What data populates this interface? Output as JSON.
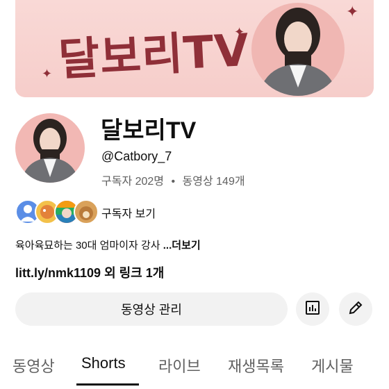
{
  "banner": {
    "title": "달보리TV"
  },
  "channel": {
    "name": "달보리TV",
    "handle": "@Catbory_7",
    "subscribers": "구독자 202명",
    "videos": "동영상 149개",
    "separator": "•"
  },
  "subscribers_row": {
    "label": "구독자 보기"
  },
  "description": {
    "text": "육아육묘하는 30대 엄마이자 강사 ",
    "more": "...더보기"
  },
  "link": {
    "text": "litt.ly/nmk1109 외 링크 1개"
  },
  "actions": {
    "manage_label": "동영상 관리",
    "analytics_icon": "bar-chart-icon",
    "edit_icon": "pencil-icon"
  },
  "tabs": [
    {
      "label": "동영상",
      "active": false
    },
    {
      "label": "Shorts",
      "active": true
    },
    {
      "label": "라이브",
      "active": false
    },
    {
      "label": "재생목록",
      "active": false
    },
    {
      "label": "게시물",
      "active": false
    }
  ],
  "colors": {
    "banner_bg": "#f6cdca",
    "banner_text": "#8f2f38",
    "button_bg": "#f2f2f2",
    "secondary_text": "#606060"
  }
}
